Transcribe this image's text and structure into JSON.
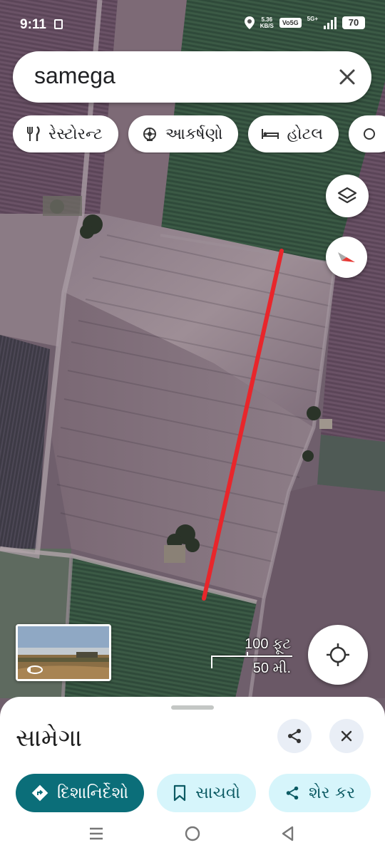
{
  "status_bar": {
    "time": "9:11",
    "net_speed_value": "5.36",
    "net_speed_unit": "KB/S",
    "volte": "Vo5G",
    "signal_label": "5G+",
    "battery": "70"
  },
  "search": {
    "query": "samega",
    "clear_icon": "close-icon"
  },
  "chips": [
    {
      "label": "રેસ્ટોરન્ટ",
      "icon": "restaurant-icon"
    },
    {
      "label": "આકર્ષણો",
      "icon": "attraction-icon"
    },
    {
      "label": "હોટલ",
      "icon": "hotel-icon"
    }
  ],
  "map": {
    "scale_primary": "100 ફૂટ",
    "scale_secondary": "50 મી.",
    "measure_line_color": "#e8262b"
  },
  "place": {
    "name": "સામેગા"
  },
  "actions": [
    {
      "label": "દિશાનિર્દેશો",
      "icon": "directions-icon"
    },
    {
      "label": "સાચવો",
      "icon": "bookmark-icon"
    },
    {
      "label": "શેર કર",
      "icon": "share-icon"
    }
  ],
  "colors": {
    "primary_action": "#0b6e79",
    "secondary_action": "#d6f5fb"
  }
}
